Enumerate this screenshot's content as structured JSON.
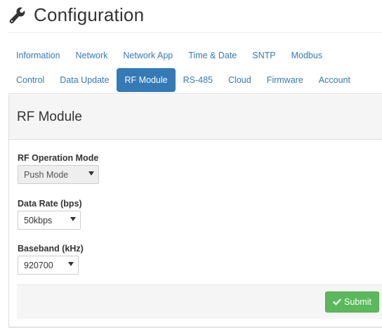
{
  "header": {
    "title": "Configuration",
    "icon": "wrench-icon"
  },
  "tabs": {
    "row1": [
      {
        "label": "Information"
      },
      {
        "label": "Network"
      },
      {
        "label": "Network App"
      },
      {
        "label": "Time & Date"
      },
      {
        "label": "SNTP"
      },
      {
        "label": "Modbus"
      }
    ],
    "row2": [
      {
        "label": "Control"
      },
      {
        "label": "Data Update"
      },
      {
        "label": "RF Module",
        "active": true
      },
      {
        "label": "RS-485"
      },
      {
        "label": "Cloud"
      },
      {
        "label": "Firmware"
      },
      {
        "label": "Account"
      }
    ]
  },
  "panel": {
    "title": "RF Module",
    "fields": {
      "rf_mode": {
        "label": "RF Operation Mode",
        "value": "Push Mode",
        "disabled": true
      },
      "data_rate": {
        "label": "Data Rate (bps)",
        "value": "50kbps"
      },
      "baseband": {
        "label": "Baseband (kHz)",
        "value": "920700"
      }
    },
    "submit_label": "Submit"
  },
  "colors": {
    "accent": "#337ab7",
    "success": "#5cb85c",
    "panel_bg": "#f5f5f5"
  }
}
